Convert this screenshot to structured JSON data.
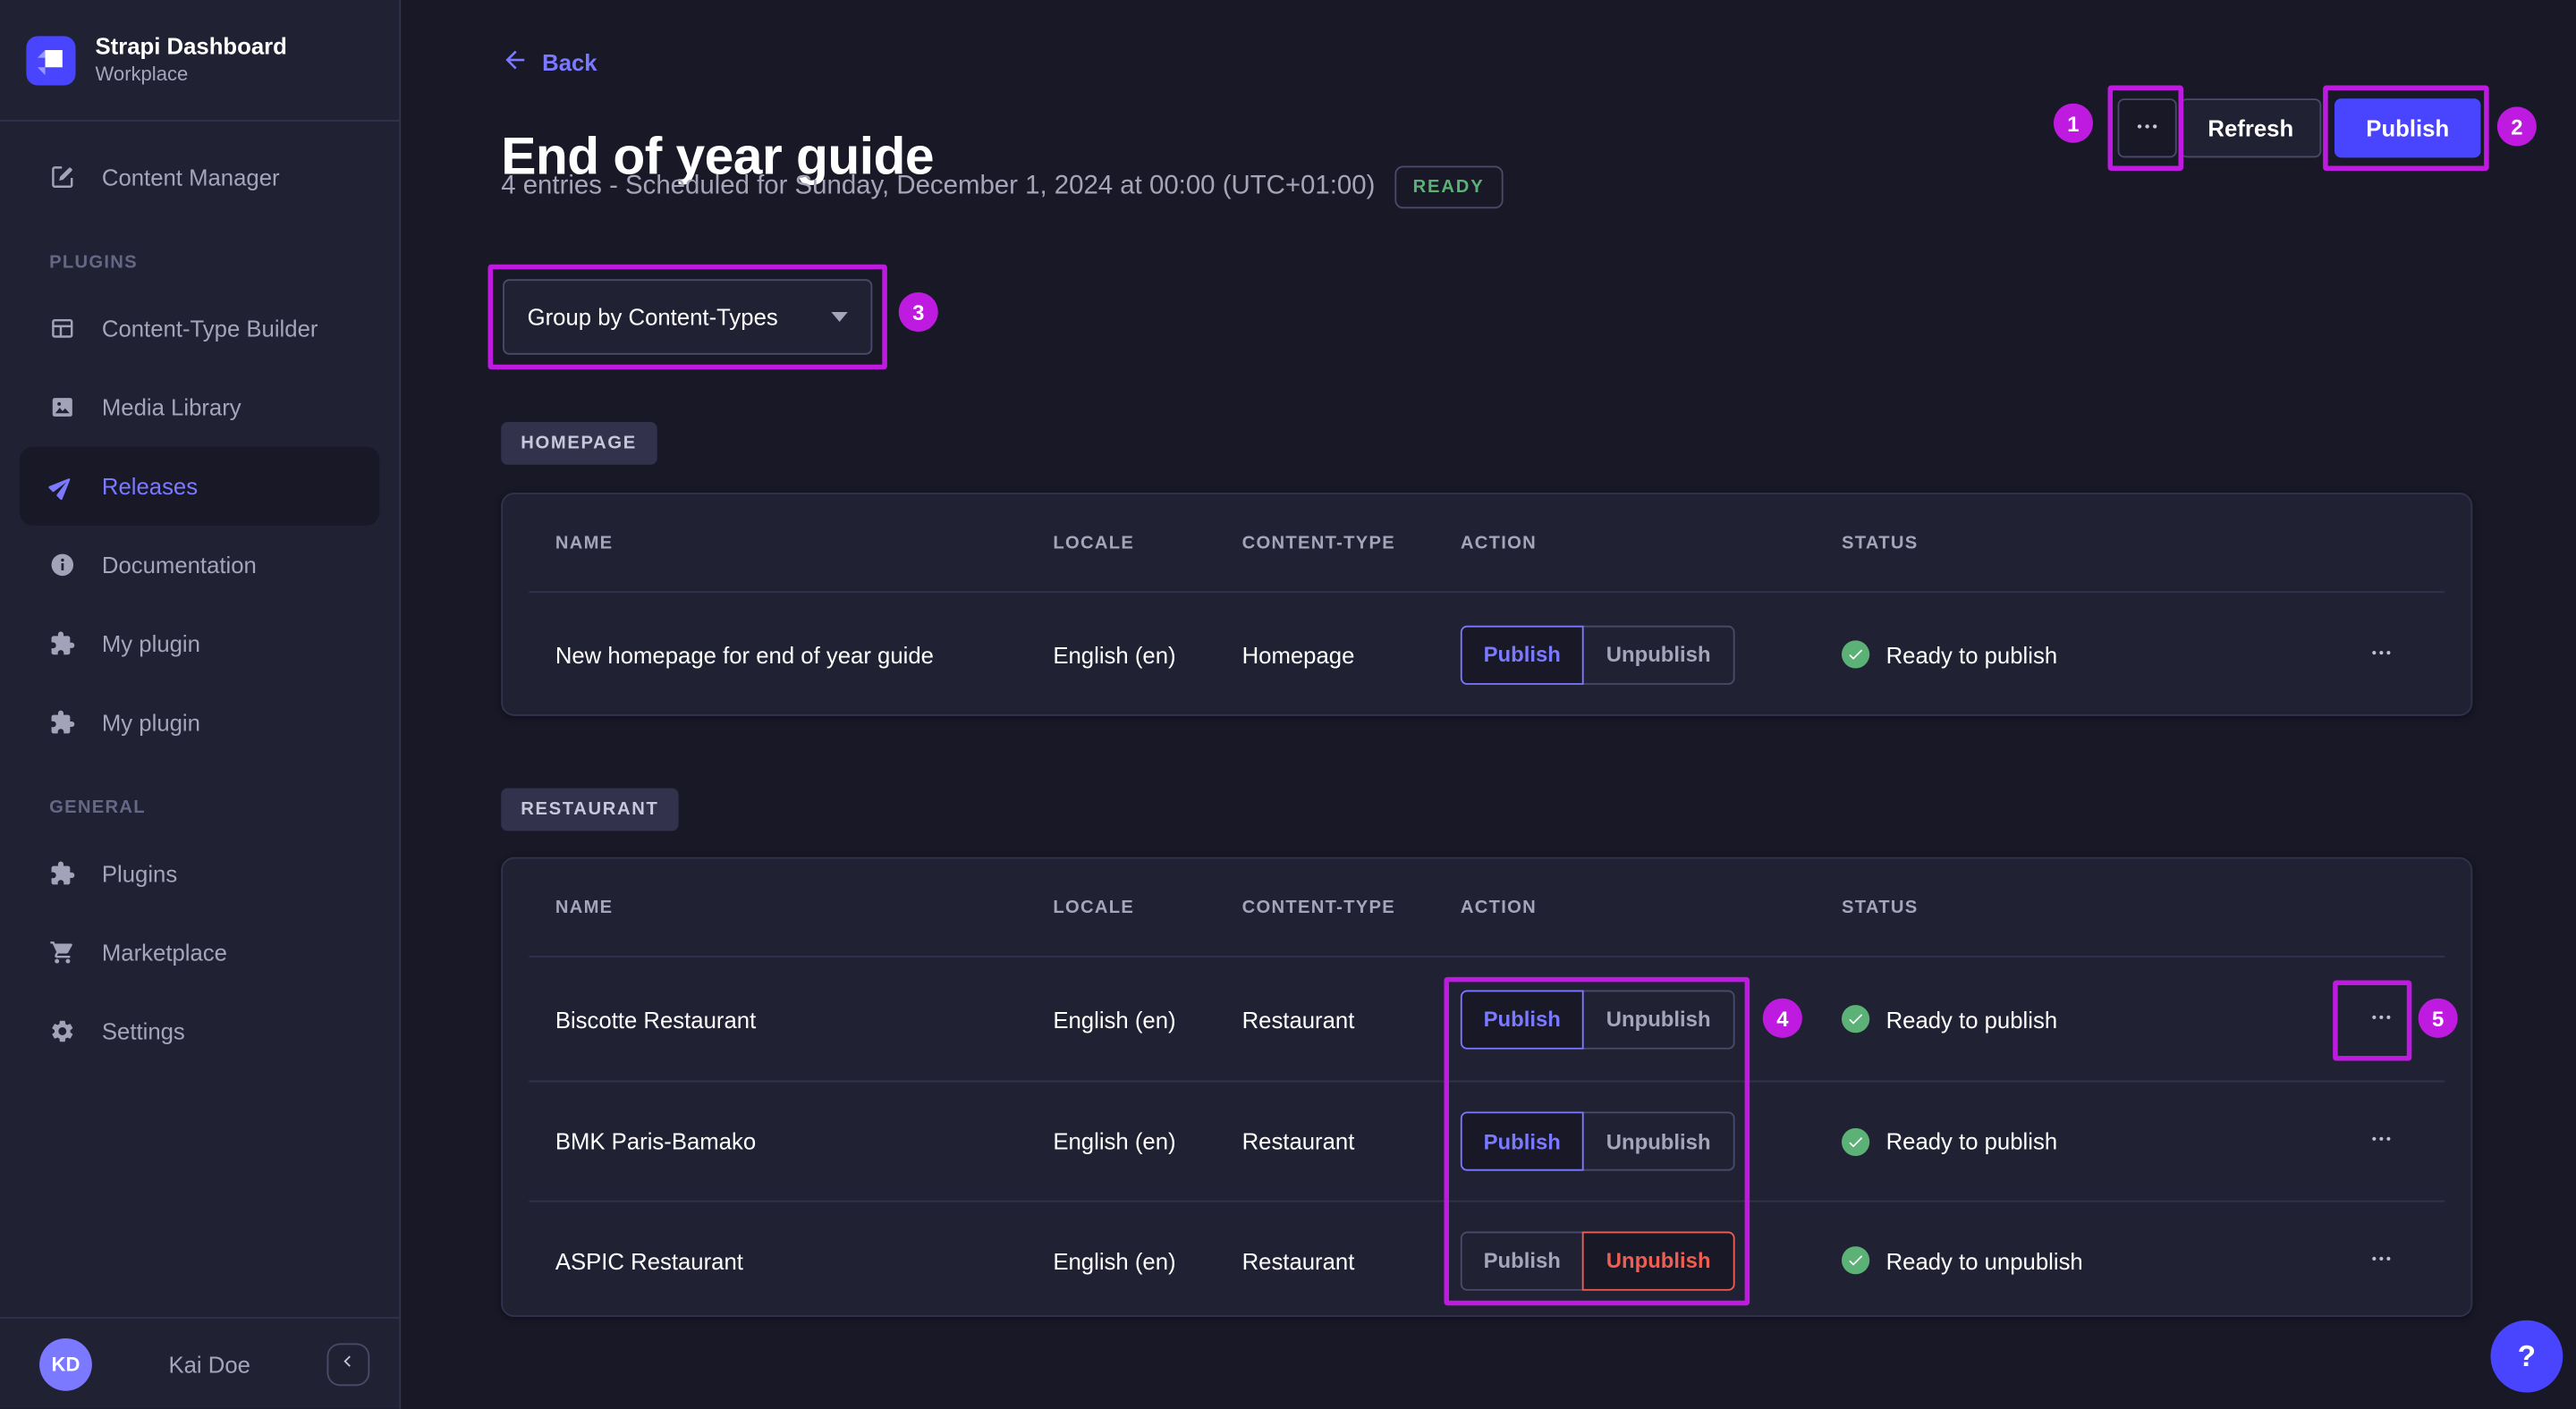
{
  "app": {
    "name": "Strapi Dashboard",
    "workspace": "Workplace"
  },
  "sidebar": {
    "content_manager": {
      "label": "Content Manager"
    },
    "sections": [
      {
        "label": "PLUGINS",
        "items": [
          {
            "label": "Content-Type Builder",
            "icon": "layout-icon"
          },
          {
            "label": "Media Library",
            "icon": "image-icon"
          },
          {
            "label": "Releases",
            "icon": "paper-plane-icon",
            "active": true
          },
          {
            "label": "Documentation",
            "icon": "info-icon"
          },
          {
            "label": "My plugin",
            "icon": "puzzle-icon"
          },
          {
            "label": "My plugin",
            "icon": "puzzle-icon"
          }
        ]
      },
      {
        "label": "GENERAL",
        "items": [
          {
            "label": "Plugins",
            "icon": "puzzle-icon"
          },
          {
            "label": "Marketplace",
            "icon": "cart-icon"
          },
          {
            "label": "Settings",
            "icon": "gear-icon"
          }
        ]
      }
    ],
    "footer": {
      "avatar_initials": "KD",
      "user_name": "Kai Doe"
    }
  },
  "header": {
    "back_label": "Back",
    "title": "End of year guide",
    "subtitle": "4 entries - Scheduled for Sunday, December 1, 2024 at 00:00 (UTC+01:00)",
    "status_badge": "READY",
    "toolbar": {
      "refresh_label": "Refresh",
      "publish_label": "Publish"
    }
  },
  "filters": {
    "group_by_value": "Group by Content-Types"
  },
  "table_headers": [
    "NAME",
    "LOCALE",
    "CONTENT-TYPE",
    "ACTION",
    "STATUS"
  ],
  "sections": [
    {
      "badge": "HOMEPAGE",
      "rows": [
        {
          "name": "New homepage for end of year guide",
          "locale": "English (en)",
          "content_type": "Homepage",
          "actions": {
            "publish": "Publish",
            "unpublish": "Unpublish",
            "selected": "publish"
          },
          "status": "Ready to publish"
        }
      ]
    },
    {
      "badge": "RESTAURANT",
      "rows": [
        {
          "name": "Biscotte Restaurant",
          "locale": "English (en)",
          "content_type": "Restaurant",
          "actions": {
            "publish": "Publish",
            "unpublish": "Unpublish",
            "selected": "publish"
          },
          "status": "Ready to publish"
        },
        {
          "name": "BMK Paris-Bamako",
          "locale": "English (en)",
          "content_type": "Restaurant",
          "actions": {
            "publish": "Publish",
            "unpublish": "Unpublish",
            "selected": "publish"
          },
          "status": "Ready to publish"
        },
        {
          "name": "ASPIC Restaurant",
          "locale": "English (en)",
          "content_type": "Restaurant",
          "actions": {
            "publish": "Publish",
            "unpublish": "Unpublish",
            "selected": "unpublish"
          },
          "status": "Ready to unpublish"
        }
      ]
    }
  ],
  "annotations": [
    {
      "number": "1"
    },
    {
      "number": "2"
    },
    {
      "number": "3"
    },
    {
      "number": "4"
    },
    {
      "number": "5"
    }
  ],
  "help": {
    "label": "?"
  },
  "colors": {
    "accent": "#4945ff",
    "accent_light": "#7b79ff",
    "success": "#5cb176",
    "danger": "#ee5e52",
    "annotation": "#bf1be0",
    "page_bg": "#181826",
    "card_bg": "#212134"
  }
}
